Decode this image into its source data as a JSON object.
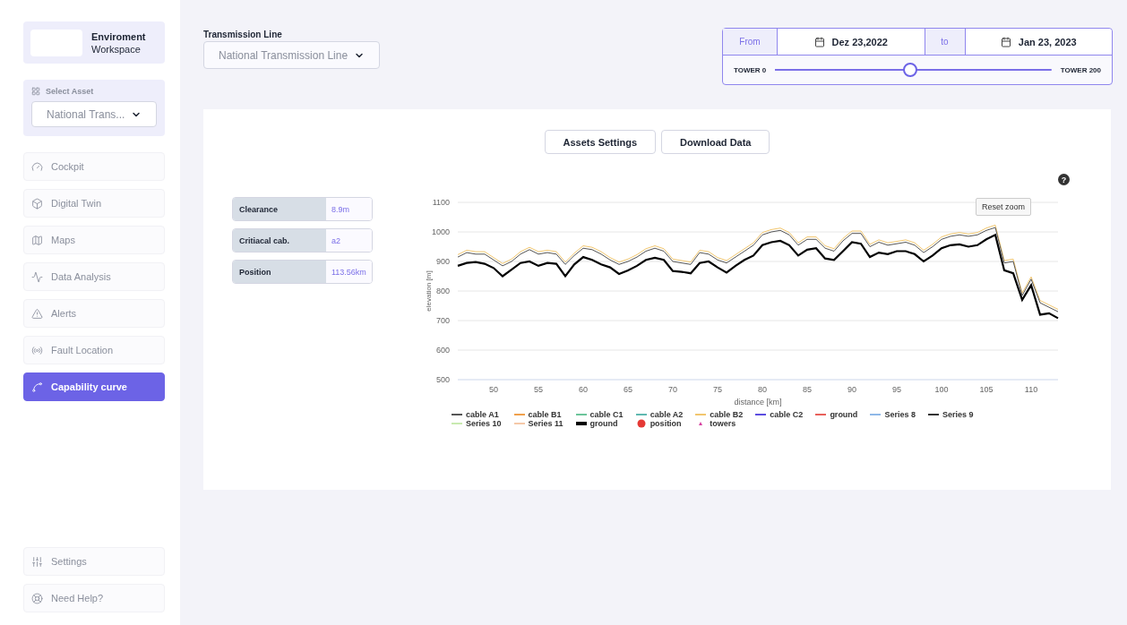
{
  "workspace": {
    "title": "Enviroment",
    "subtitle": "Workspace"
  },
  "asset_select": {
    "label": "Select Asset",
    "value": "National Trans..."
  },
  "nav": [
    {
      "label": "Cockpit",
      "selected": false
    },
    {
      "label": "Digital Twin",
      "selected": false
    },
    {
      "label": "Maps",
      "selected": false
    },
    {
      "label": "Data Analysis",
      "selected": false
    },
    {
      "label": "Alerts",
      "selected": false
    },
    {
      "label": "Fault Location",
      "selected": false
    },
    {
      "label": "Capability curve",
      "selected": true
    }
  ],
  "footer_nav": [
    {
      "label": "Settings"
    },
    {
      "label": "Need Help?"
    }
  ],
  "transmission_line": {
    "label": "Transmission Line",
    "value": "National Transmission Line"
  },
  "date_range": {
    "from_label": "From",
    "from": "Dez 23,2022",
    "to_label": "to",
    "to": "Jan 23, 2023",
    "start": "TOWER 0",
    "end": "TOWER 200",
    "level": 0.49
  },
  "buttons": [
    "Assets Settings",
    "Download Data"
  ],
  "metrics": [
    {
      "label": "Clearance",
      "value": "8.9m"
    },
    {
      "label": "Critiacal cab.",
      "value": "a2"
    },
    {
      "label": "Position",
      "value": "113.56km"
    }
  ],
  "chart": {
    "help": "?",
    "reset": "Reset zoom",
    "legend": [
      {
        "name": "cable A1",
        "color": "#555555",
        "kind": "line"
      },
      {
        "name": "cable B1",
        "color": "#f0a04b",
        "kind": "line"
      },
      {
        "name": "cable C1",
        "color": "#6cc59a",
        "kind": "line"
      },
      {
        "name": "cable A2",
        "color": "#5fb8b0",
        "kind": "line"
      },
      {
        "name": "cable B2",
        "color": "#f2c66e",
        "kind": "line"
      },
      {
        "name": "cable C2",
        "color": "#5b4de0",
        "kind": "line"
      },
      {
        "name": "ground",
        "color": "#e8605a",
        "kind": "line"
      },
      {
        "name": "Series 8",
        "color": "#8fb8e8",
        "kind": "line"
      },
      {
        "name": "Series 9",
        "color": "#333333",
        "kind": "line"
      },
      {
        "name": "Series 10",
        "color": "#c8eab0",
        "kind": "line"
      },
      {
        "name": "Series 11",
        "color": "#f5c8a8",
        "kind": "line"
      },
      {
        "name": "ground",
        "color": "#000000",
        "kind": "thick"
      },
      {
        "name": "position",
        "color": "#e53935",
        "kind": "dot"
      },
      {
        "name": "towers",
        "color": "#d63fa0",
        "kind": "triangle"
      }
    ],
    "chart_data": {
      "type": "line",
      "grid": true,
      "xlabel": "distance [km]",
      "ylabel": "elevation [m]",
      "xlim": [
        46,
        113
      ],
      "ylim": [
        500,
        1100
      ],
      "xticks": [
        50,
        55,
        60,
        65,
        70,
        75,
        80,
        85,
        90,
        95,
        100,
        105,
        110
      ],
      "yticks": [
        500,
        600,
        700,
        800,
        900,
        1000,
        1100
      ],
      "x": [
        46,
        47,
        48,
        49,
        50,
        51,
        52,
        53,
        54,
        55,
        56,
        57,
        58,
        59,
        60,
        61,
        62,
        63,
        64,
        65,
        66,
        67,
        68,
        69,
        70,
        71,
        72,
        73,
        74,
        75,
        76,
        77,
        78,
        79,
        80,
        81,
        82,
        83,
        84,
        85,
        86,
        87,
        88,
        89,
        90,
        91,
        92,
        93,
        94,
        95,
        96,
        97,
        98,
        99,
        100,
        101,
        102,
        103,
        104,
        105,
        106,
        107,
        108,
        109,
        110,
        111,
        112,
        113
      ],
      "series": [
        {
          "color": "#f2c66e",
          "values": [
            923,
            938,
            933,
            933,
            913,
            893,
            908,
            933,
            948,
            933,
            938,
            933,
            898,
            928,
            953,
            948,
            933,
            913,
            898,
            908,
            923,
            943,
            953,
            943,
            908,
            903,
            898,
            938,
            933,
            913,
            903,
            923,
            943,
            963,
            998,
            1008,
            1013,
            998,
            963,
            983,
            983,
            953,
            943,
            978,
            1003,
            1003,
            958,
            973,
            963,
            968,
            973,
            963,
            938,
            958,
            983,
            993,
            998,
            993,
            998,
            1013,
            1023,
            903,
            908,
            793,
            848,
            768,
            753,
            738
          ]
        },
        {
          "color": "#555555",
          "values": [
            915,
            930,
            925,
            925,
            905,
            885,
            900,
            925,
            940,
            925,
            930,
            925,
            890,
            920,
            945,
            940,
            925,
            905,
            890,
            900,
            915,
            935,
            945,
            935,
            900,
            895,
            890,
            930,
            925,
            905,
            895,
            915,
            935,
            955,
            990,
            1000,
            1005,
            990,
            955,
            975,
            975,
            945,
            935,
            970,
            995,
            995,
            950,
            965,
            955,
            960,
            965,
            955,
            930,
            950,
            975,
            985,
            990,
            985,
            990,
            1005,
            1015,
            895,
            900,
            785,
            840,
            760,
            745,
            730
          ]
        },
        {
          "color": "#000000",
          "values": [
            885,
            895,
            898,
            892,
            878,
            850,
            872,
            895,
            900,
            885,
            895,
            892,
            850,
            890,
            915,
            905,
            890,
            880,
            858,
            870,
            885,
            905,
            912,
            905,
            868,
            865,
            860,
            895,
            900,
            880,
            862,
            885,
            905,
            920,
            955,
            965,
            970,
            955,
            920,
            940,
            945,
            910,
            905,
            935,
            965,
            960,
            915,
            930,
            925,
            935,
            935,
            925,
            900,
            920,
            945,
            955,
            958,
            950,
            955,
            975,
            990,
            870,
            860,
            770,
            820,
            720,
            725,
            708
          ]
        }
      ]
    }
  }
}
